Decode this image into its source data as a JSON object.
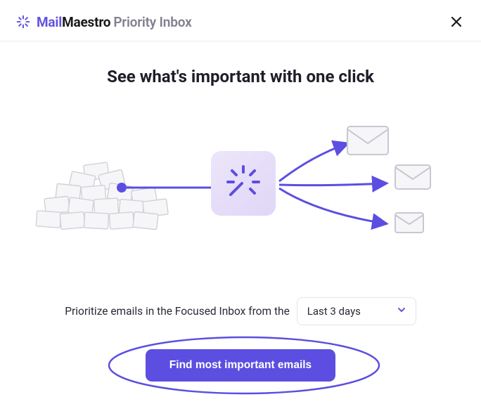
{
  "header": {
    "brand_mail": "Mail",
    "brand_maestro": "Maestro",
    "brand_sub": "Priority Inbox"
  },
  "main": {
    "heading": "See what's important with one click",
    "prioritize_label": "Prioritize emails in the Focused Inbox from the",
    "dropdown_selected": "Last 3 days",
    "cta_label": "Find most important emails"
  }
}
